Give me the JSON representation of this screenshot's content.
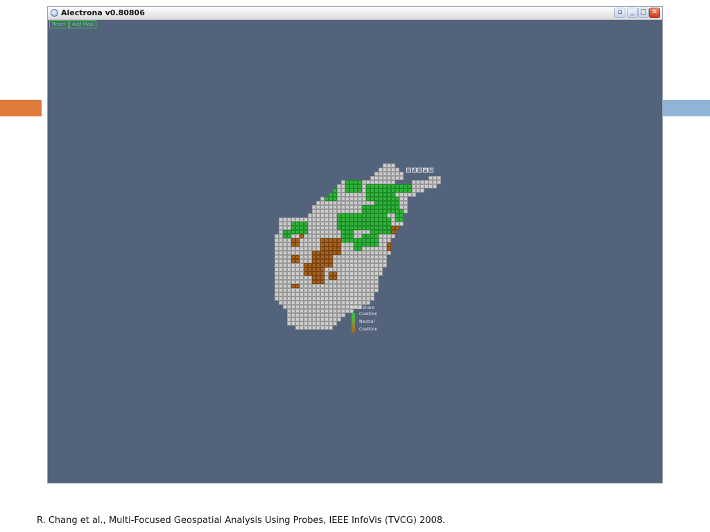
{
  "window": {
    "title": "Alectrona v0.80806",
    "controls": {
      "restore": "▫",
      "minimize": "_",
      "maximize": "□",
      "close": "✕"
    }
  },
  "toolbar": {
    "reset_label": "Reset",
    "add_map_label": "Add Map"
  },
  "probe_controls": [
    "C",
    "C",
    "L",
    "M",
    "X"
  ],
  "legend": {
    "title": "Mind-Share",
    "items": [
      "Coalition",
      "Neutral",
      "Coalition"
    ],
    "colors": {
      "high": "#2ec93b",
      "low": "#b0621c"
    }
  },
  "map": {
    "cell_colors": {
      "neutral": "#cdcdcd",
      "coalition_positive": "#2fb53a",
      "coalition_negative": "#a8631c"
    }
  },
  "caption": "R. Chang et al., Multi-Focused Geospatial Analysis Using Probes, IEEE InfoVis (TVCG) 2008.",
  "slide_accents": {
    "left": "#e07b3c",
    "right": "#8fb5d6"
  },
  "window_background": "#54637c"
}
